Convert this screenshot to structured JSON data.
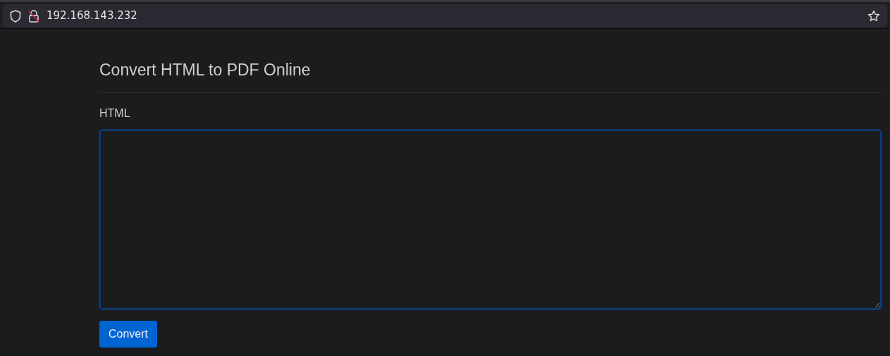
{
  "browser": {
    "url": "192.168.143.232",
    "bookmarked": false
  },
  "page": {
    "title": "Convert HTML to PDF Online",
    "field": {
      "label": "HTML",
      "focused": true
    },
    "button": "Convert"
  }
}
